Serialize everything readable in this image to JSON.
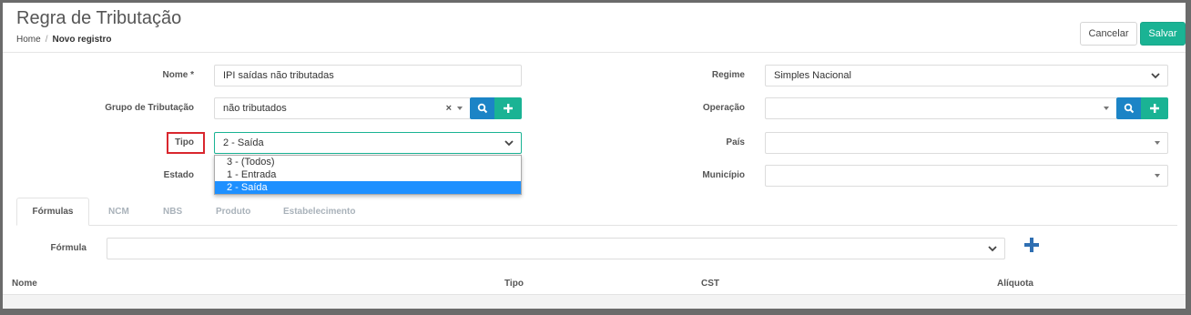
{
  "header": {
    "title": "Regra de Tributação",
    "breadcrumb": {
      "home": "Home",
      "separator": "/",
      "current": "Novo registro"
    },
    "cancel_label": "Cancelar",
    "save_label": "Salvar"
  },
  "form": {
    "nome": {
      "label": "Nome *",
      "value": "IPI saídas não tributadas"
    },
    "grupo": {
      "label": "Grupo de Tributação",
      "value": "não tributados",
      "clear": "×"
    },
    "tipo": {
      "label": "Tipo",
      "value": "2 - Saída"
    },
    "estado": {
      "label": "Estado",
      "value": ""
    },
    "regime": {
      "label": "Regime",
      "value": "Simples Nacional"
    },
    "operacao": {
      "label": "Operação",
      "value": ""
    },
    "pais": {
      "label": "País",
      "value": ""
    },
    "municipio": {
      "label": "Município",
      "value": ""
    }
  },
  "tipo_dropdown": {
    "options": [
      "3 - (Todos)",
      "1 - Entrada",
      "2 - Saída"
    ],
    "selected_index": 2
  },
  "tabs": [
    "Fórmulas",
    "NCM",
    "NBS",
    "Produto",
    "Estabelecimento"
  ],
  "formula": {
    "label": "Fórmula",
    "value": ""
  },
  "table": {
    "columns": [
      "Nome",
      "Tipo",
      "CST",
      "Alíquota"
    ]
  },
  "icons": {
    "search": "search-icon",
    "add": "plus-icon",
    "chevron": "chevron-down-icon",
    "caret": "caret-down-icon",
    "clear": "close-icon"
  },
  "colors": {
    "primary_green": "#1ab394",
    "primary_blue": "#1c84c6",
    "highlight_red": "#d9272e",
    "selected_option": "#1e90ff"
  }
}
